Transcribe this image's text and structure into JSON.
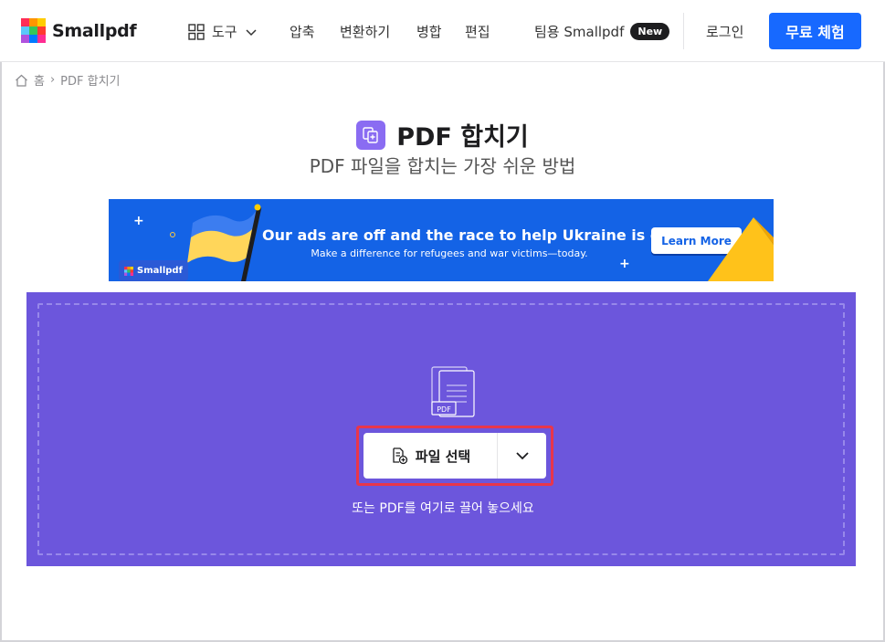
{
  "brand": {
    "name": "Smallpdf",
    "logo_colors": [
      "#ff2d55",
      "#ff9500",
      "#ffcc00",
      "#5ac8fa",
      "#34c759",
      "#ff3b30",
      "#af52de",
      "#007aff",
      "#ff2d92"
    ]
  },
  "nav": {
    "tools_label": "도구",
    "compress": "압축",
    "convert": "변환하기",
    "merge": "병합",
    "edit": "편집",
    "team": "팀용 Smallpdf",
    "new_badge": "New",
    "login": "로그인",
    "free_trial": "무료 체험"
  },
  "breadcrumb": {
    "home": "홈",
    "separator": "›",
    "current": "PDF 합치기"
  },
  "page": {
    "title": "PDF 합치기",
    "subtitle": "PDF 파일을 합치는 가장 쉬운 방법"
  },
  "banner": {
    "badge": "Smallpdf",
    "headline": "Our ads are off and the race to help Ukraine is on",
    "subline": "Make a difference for refugees and war victims—today.",
    "button": "Learn More",
    "colors": {
      "background": "#1463e6",
      "flag_blue": "#3c7df0",
      "flag_yellow": "#ffd65a"
    }
  },
  "dropzone": {
    "select_button": "파일 선택",
    "hint": "또는 PDF를 여기로 끌어 놓으세요",
    "file_badge": "PDF",
    "colors": {
      "background": "#6c56dc",
      "highlight": "#e8364b"
    }
  },
  "colors": {
    "accent": "#1769ff",
    "tool_purple": "#8a6cf2"
  }
}
